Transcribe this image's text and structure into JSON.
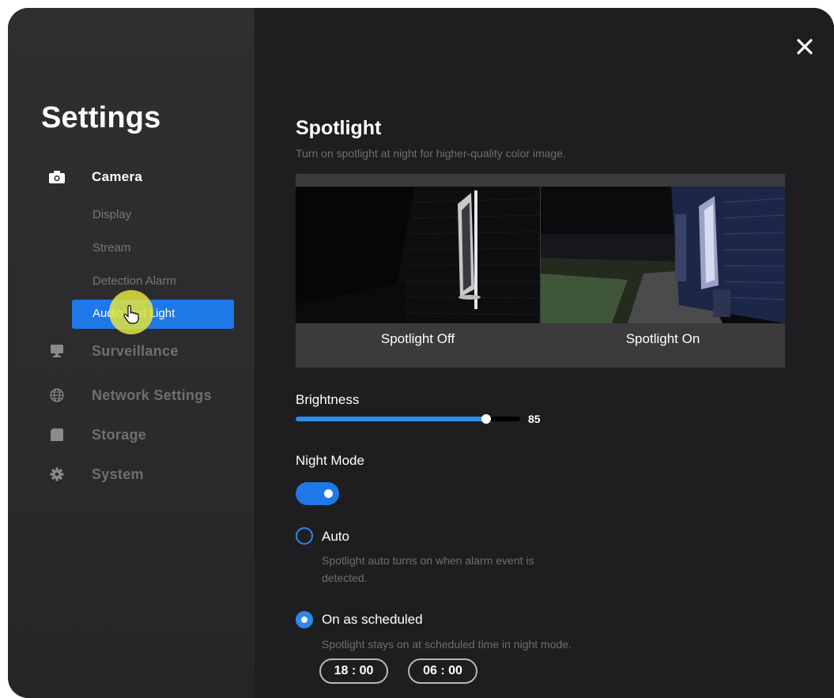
{
  "sidebar": {
    "title": "Settings",
    "camera": {
      "label": "Camera",
      "icon": "camera-icon"
    },
    "camera_subitems": [
      "Display",
      "Stream",
      "Detection Alarm"
    ],
    "active_subitem": "Audio and Light",
    "surveillance": {
      "label": "Surveillance",
      "icon": "monitor-icon"
    },
    "network": {
      "label": "Network Settings",
      "icon": "globe-icon"
    },
    "storage": {
      "label": "Storage",
      "icon": "sd-card-icon"
    },
    "system": {
      "label": "System",
      "icon": "gear-icon"
    }
  },
  "main": {
    "title": "Spotlight",
    "subtitle": "Turn on spotlight at night for higher-quality color image.",
    "preview": {
      "off_label": "Spotlight Off",
      "on_label": "Spotlight On"
    },
    "brightness": {
      "label": "Brightness",
      "value": "85",
      "fraction": 0.85
    },
    "night_mode": {
      "label": "Night Mode",
      "enabled": true
    },
    "options": {
      "auto": {
        "label": "Auto",
        "desc_line1": "Spotlight auto turns on when alarm event is",
        "desc_line2": "detected.",
        "selected": false
      },
      "scheduled": {
        "label": "On as scheduled",
        "desc": "Spotlight stays on at scheduled time in night mode.",
        "selected": true
      }
    },
    "schedule": {
      "start": "18 : 00",
      "end": "06 : 00"
    }
  },
  "colors": {
    "accent": "#1e78e8",
    "highlight": "#e2e43c"
  }
}
